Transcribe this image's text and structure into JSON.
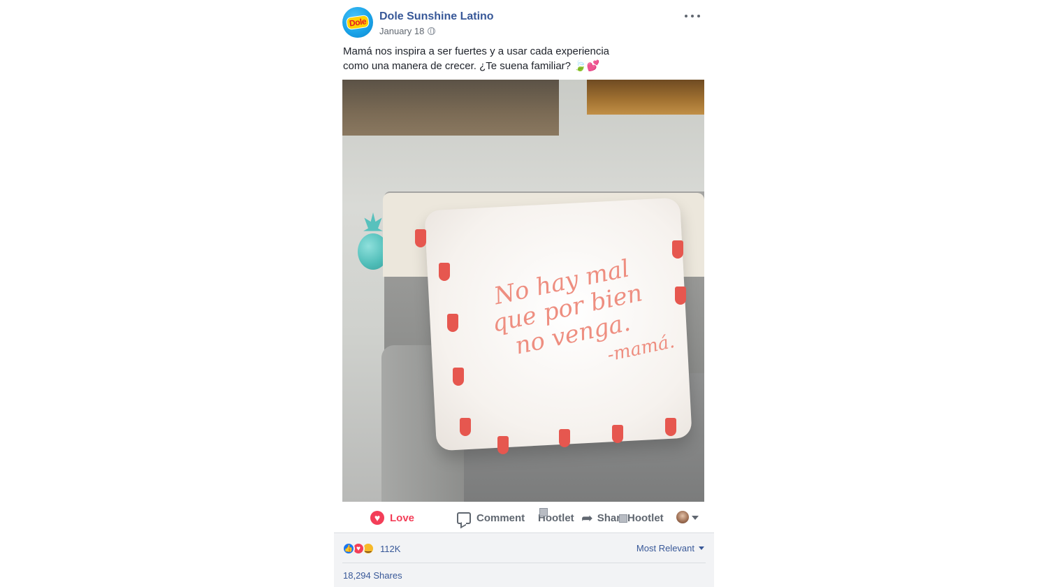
{
  "post": {
    "page_name": "Dole Sunshine Latino",
    "avatar_logo": "Dole",
    "date": "January 18",
    "privacy_icon": "globe-icon",
    "more_icon": "more-dots-icon",
    "text": "Mamá nos inspira a ser fuertes y a usar cada experiencia como una manera de crecer. ¿Te suena familiar?",
    "emojis": [
      "🍃",
      "💕"
    ],
    "photo": {
      "quote_lines": [
        "No hay mal",
        "que por bien",
        "no venga."
      ],
      "signature": "-mamá."
    }
  },
  "actions": {
    "love": "Love",
    "comment": "Comment",
    "hootlet": "Hootlet",
    "share": "Share",
    "share_hootlet": "Hootlet"
  },
  "footer": {
    "reaction_icons": [
      "like",
      "love",
      "haha"
    ],
    "reaction_count": "112K",
    "sort": "Most Relevant",
    "shares": "18,294 Shares"
  },
  "colors": {
    "link": "#385898",
    "love": "#f33e58",
    "text": "#1d2129",
    "muted": "#606770",
    "footer_bg": "#f2f3f5"
  }
}
